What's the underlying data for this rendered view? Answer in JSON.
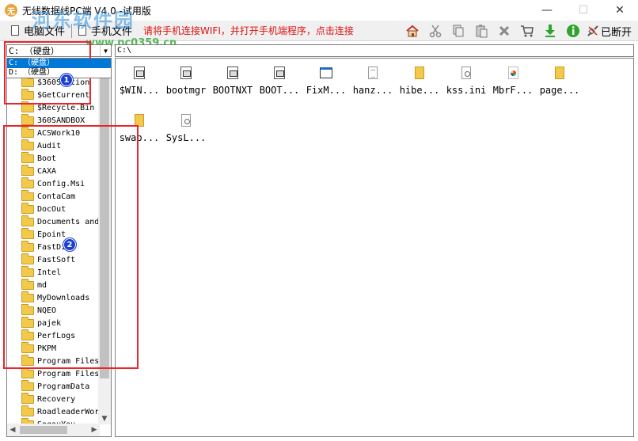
{
  "window": {
    "title": "无线数据线PC端 V4.0 -试用版",
    "logo_text": "无",
    "minimize": "—",
    "maximize": "☐",
    "close": "✕"
  },
  "watermark": {
    "main": "河东软件园",
    "url": "www.pc0359.cn"
  },
  "toolbar": {
    "computer_files": "电脑文件",
    "phone_files": "手机文件",
    "hint": "请将手机连接WIFI，并打开手机端程序，点击连接",
    "disconnect": "已断开",
    "icons": [
      "home-icon",
      "cut-icon",
      "copy-icon",
      "paste-icon",
      "delete-icon",
      "cart-icon",
      "download-icon",
      "info-icon",
      "disconnect-icon"
    ]
  },
  "left_pane": {
    "drive_selected": "C: （硬盘）",
    "drive_options": [
      {
        "label": "C: （硬盘）",
        "selected": true
      },
      {
        "label": "D: （硬盘）",
        "selected": false
      }
    ],
    "folders": [
      "$360Section",
      "$GetCurrent",
      "$Recycle.Bin",
      "360SANDBOX",
      "ACSWork10",
      "Audit",
      "Boot",
      "CAXA",
      "Config.Msi",
      "ContaCam",
      "DocOut",
      "Documents and",
      "Epoint",
      "FastDisk",
      "FastSoft",
      "Intel",
      "md",
      "MyDownloads",
      "NQEO",
      "pajek",
      "PerfLogs",
      "PKPM",
      "Program Files",
      "Program Files",
      "ProgramData",
      "Recovery",
      "RoadleaderWor",
      "SogouYou"
    ]
  },
  "right_pane": {
    "path": "C:\\",
    "files": [
      {
        "name": "$WIN...",
        "icon": "system-file-icon"
      },
      {
        "name": "bootmgr",
        "icon": "system-file-icon"
      },
      {
        "name": "BOOTNXT",
        "icon": "system-file-icon"
      },
      {
        "name": "BOOT...",
        "icon": "system-file-icon"
      },
      {
        "name": "FixM...",
        "icon": "application-icon"
      },
      {
        "name": "hanz...",
        "icon": "document-icon"
      },
      {
        "name": "hibe...",
        "icon": "folder-file-icon"
      },
      {
        "name": "kss.ini",
        "icon": "ini-file-icon"
      },
      {
        "name": "MbrF...",
        "icon": "color-file-icon"
      },
      {
        "name": "page...",
        "icon": "folder-file-icon"
      },
      {
        "name": "swap...",
        "icon": "folder-file-icon"
      },
      {
        "name": "SysL...",
        "icon": "ini-file-icon"
      }
    ]
  },
  "annotations": {
    "one": "1",
    "two": "2",
    "box_color": "#e8262b",
    "badge_color": "#1a3fd1"
  },
  "colors": {
    "hint_red": "#e01010",
    "selection_blue": "#0078d7",
    "folder_yellow": "#f3c94b"
  }
}
